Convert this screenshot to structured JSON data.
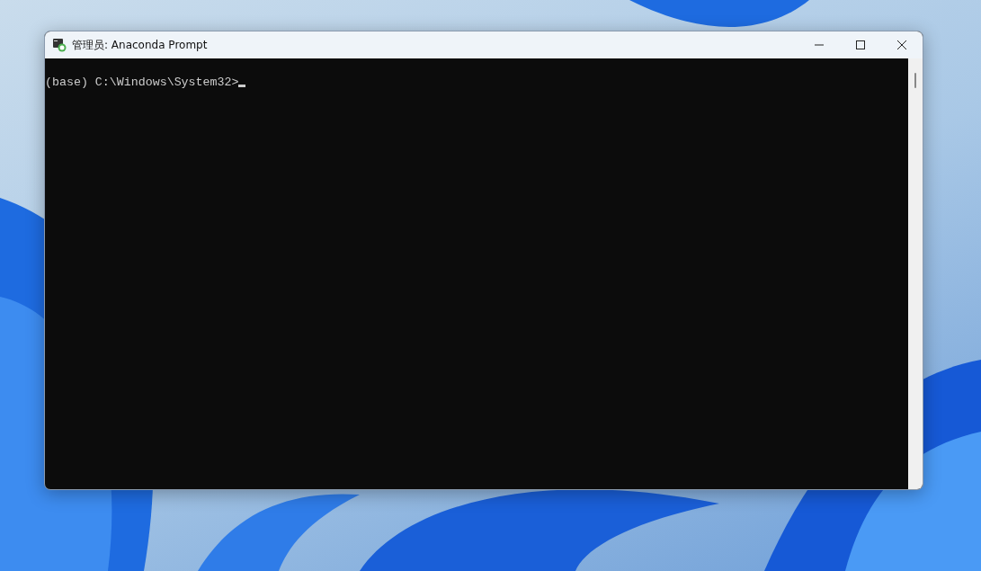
{
  "window": {
    "title": "管理员: Anaconda Prompt"
  },
  "console": {
    "lines": [
      "(base) C:\\Windows\\System32>"
    ],
    "cursor": true
  }
}
